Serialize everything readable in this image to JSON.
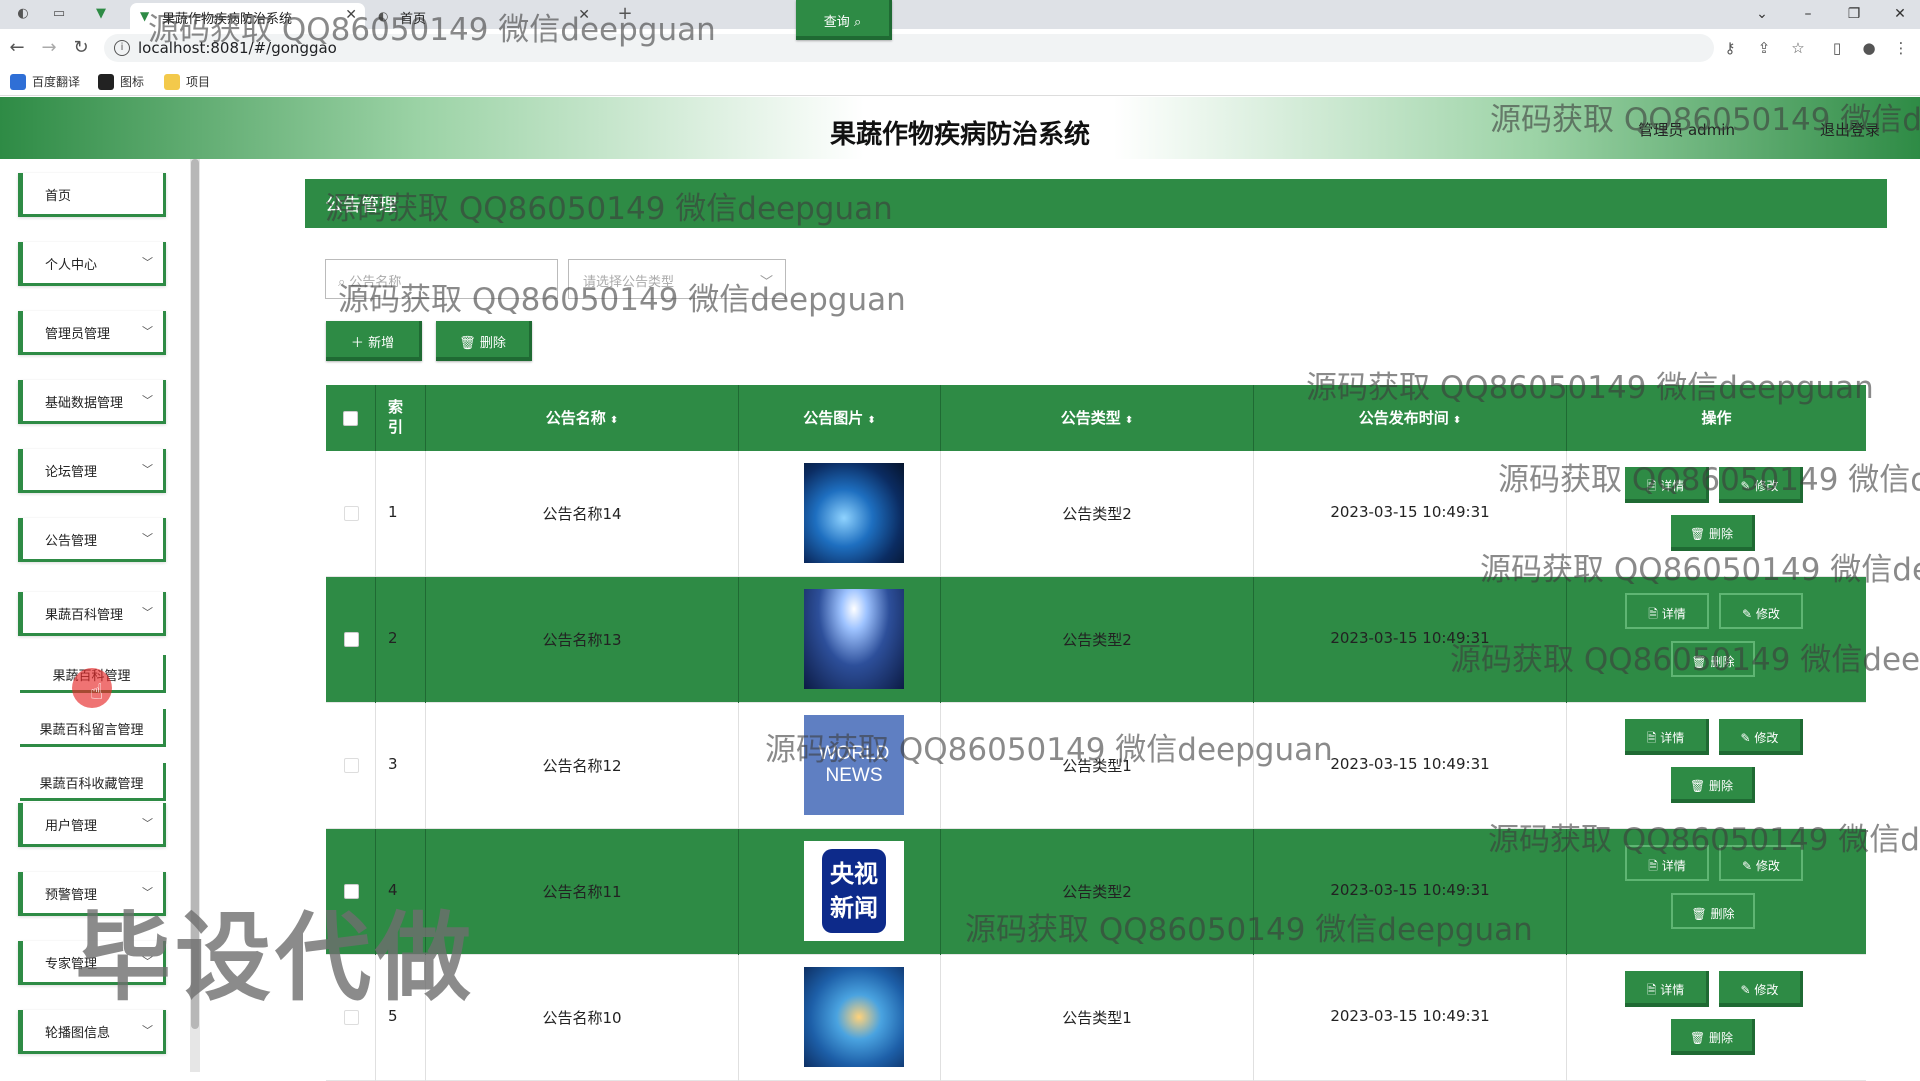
{
  "browser": {
    "tabs": [
      {
        "title": "果蔬作物疾病防治系统",
        "active": true
      },
      {
        "title": "首页",
        "active": false
      }
    ],
    "new_tab": "+",
    "url": "localhost:8081/#/gonggao",
    "bookmarks": [
      "百度翻译",
      "图标",
      "项目"
    ]
  },
  "header": {
    "title": "果蔬作物疾病防治系统",
    "admin_label": "管理员 admin",
    "logout": "退出登录"
  },
  "sidebar": {
    "items": [
      {
        "label": "首页",
        "expandable": false
      },
      {
        "label": "个人中心",
        "expandable": true
      },
      {
        "label": "管理员管理",
        "expandable": true
      },
      {
        "label": "基础数据管理",
        "expandable": true
      },
      {
        "label": "论坛管理",
        "expandable": true
      },
      {
        "label": "公告管理",
        "expandable": true
      },
      {
        "label": "果蔬百科管理",
        "expandable": true
      },
      {
        "label": "用户管理",
        "expandable": true
      },
      {
        "label": "预警管理",
        "expandable": true
      },
      {
        "label": "专家管理",
        "expandable": true
      },
      {
        "label": "轮播图信息",
        "expandable": true
      }
    ],
    "sub_items": [
      "果蔬百科管理",
      "果蔬百科留言管理",
      "果蔬百科收藏管理"
    ]
  },
  "main": {
    "breadcrumb": "公告管理",
    "search_placeholder": "公告名称",
    "type_placeholder": "请选择公告类型",
    "query_button": "查询",
    "add_button": "新增",
    "delete_button": "删除",
    "columns": [
      "索引",
      "公告名称",
      "公告图片",
      "公告类型",
      "公告发布时间",
      "操作"
    ],
    "rows": [
      {
        "index": "1",
        "name": "公告名称14",
        "type": "公告类型2",
        "time": "2023-03-15 10:49:31",
        "image": "globe-news-icon"
      },
      {
        "index": "2",
        "name": "公告名称13",
        "type": "公告类型2",
        "time": "2023-03-15 10:49:31",
        "image": "spotlight-news-icon"
      },
      {
        "index": "3",
        "name": "公告名称12",
        "type": "公告类型1",
        "time": "2023-03-15 10:49:31",
        "image": "world-news-icon"
      },
      {
        "index": "4",
        "name": "公告名称11",
        "type": "公告类型2",
        "time": "2023-03-15 10:49:31",
        "image": "cctv-news-icon"
      },
      {
        "index": "5",
        "name": "公告名称10",
        "type": "公告类型1",
        "time": "2023-03-15 10:49:31",
        "image": "news-logo-icon"
      }
    ],
    "actions": {
      "detail": "详情",
      "edit": "修改",
      "delete": "删除"
    },
    "world_news_text": "WORLD NEWS",
    "cctv_text": "央视新闻"
  },
  "watermarks": {
    "line": "源码获取 QQ86050149 微信deepguan",
    "big": "毕设代做"
  },
  "colors": {
    "primary": "#2e8b45",
    "primary_dark": "#1f6a33"
  }
}
